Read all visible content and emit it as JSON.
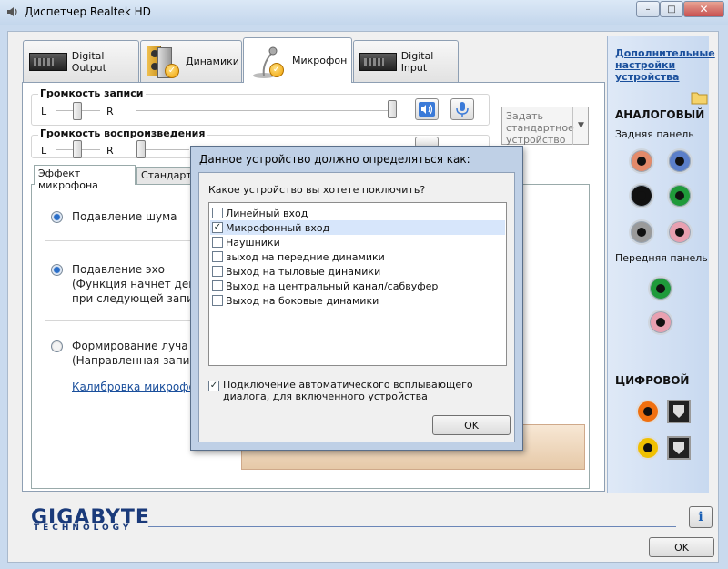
{
  "window": {
    "title": "Диспетчер Realtek HD",
    "minimize_glyph": "–",
    "maximize_glyph": "□",
    "close_glyph": "✕"
  },
  "tabs": [
    {
      "label": "Digital Output",
      "icon": "digital-output-device-icon"
    },
    {
      "label": "Динамики",
      "icon": "speakers-icon"
    },
    {
      "label": "Микрофон",
      "icon": "microphone-icon",
      "active": true
    },
    {
      "label": "Digital Input",
      "icon": "digital-input-device-icon"
    }
  ],
  "recording_volume": {
    "legend": "Громкость записи",
    "left": "L",
    "right": "R"
  },
  "playback_volume": {
    "legend": "Громкость воспроизведения",
    "left": "L",
    "right": "R"
  },
  "default_device": {
    "label": "Задать стандартное устройство",
    "arrow": "▼"
  },
  "subtabs": [
    {
      "label": "Эффект микрофона",
      "active": true
    },
    {
      "label": "Стандартн"
    }
  ],
  "options": {
    "noise": "Подавление шума",
    "echo": "Подавление эхо",
    "echo_desc1": "(Функция начнет дейст",
    "echo_desc2": "при следующей запис",
    "beam": "Формирование луча",
    "beam_desc": "(Направленная запись",
    "calibration_link": "Калибровка микрофо"
  },
  "right_panel": {
    "advanced_link": "Дополнительные настройки устройства",
    "analog_title": "АНАЛОГОВЫЙ",
    "rear_panel": "Задняя панель",
    "front_panel": "Передняя панель",
    "digital_title": "ЦИФРОВОЙ",
    "jack_colors": {
      "orange": "#e38a6a",
      "blue": "#5b7fc9",
      "black": "#111111",
      "green": "#1f9a3a",
      "grey": "#9a9a9a",
      "pink": "#e8a0b0",
      "spdif_orange": "#f07010",
      "spdif_yellow": "#f0c000"
    }
  },
  "brand": {
    "name": "GIGABYTE",
    "sub": "TECHNOLOGY"
  },
  "buttons": {
    "ok": "OK",
    "info_glyph": "i"
  },
  "dialog": {
    "title": "Данное устройство должно определяться как:",
    "question": "Какое устройство вы хотете поключить?",
    "items": [
      {
        "label": "Линейный вход",
        "checked": false
      },
      {
        "label": "Микрофонный вход",
        "checked": true
      },
      {
        "label": "Наушники",
        "checked": false
      },
      {
        "label": "выход на передние динамики",
        "checked": false
      },
      {
        "label": "Выход на тыловые динамики",
        "checked": false
      },
      {
        "label": "Выход на центральный канал/сабвуфер",
        "checked": false
      },
      {
        "label": "Выход на боковые динамики",
        "checked": false
      }
    ],
    "auto_popup": "Подключение автоматического всплывающего диалога, для включенного устройства",
    "auto_popup_checked": true,
    "ok": "OK"
  }
}
